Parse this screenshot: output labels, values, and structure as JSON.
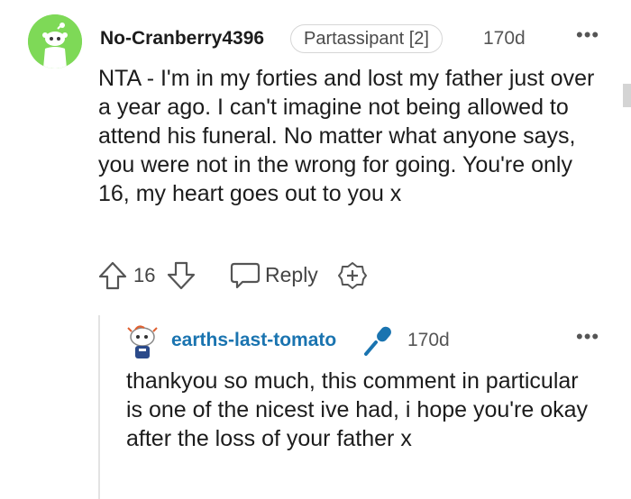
{
  "comment": {
    "username": "No-Cranberry4396",
    "flair": "Partassipant [2]",
    "time": "170d",
    "more": "•••",
    "body": "NTA - I'm in my forties and lost my father just over a year ago. I can't imagine not being allowed to attend his funeral. No matter what anyone says, you were not in the wrong for going. You're only 16, my heart goes out to you x",
    "votes": "16",
    "reply_label": "Reply",
    "avatar_color": "#7ed957",
    "icons": [
      "upvote-icon",
      "downvote-icon",
      "reply-icon",
      "award-icon"
    ]
  },
  "reply": {
    "username": "earths-last-tomato",
    "time": "170d",
    "more": "•••",
    "body": "thankyou so much, this comment in particular is one of the nicest ive had, i hope you're okay after the loss of your father x",
    "username_color": "#1a74b0",
    "icons": [
      "microphone-icon"
    ]
  }
}
